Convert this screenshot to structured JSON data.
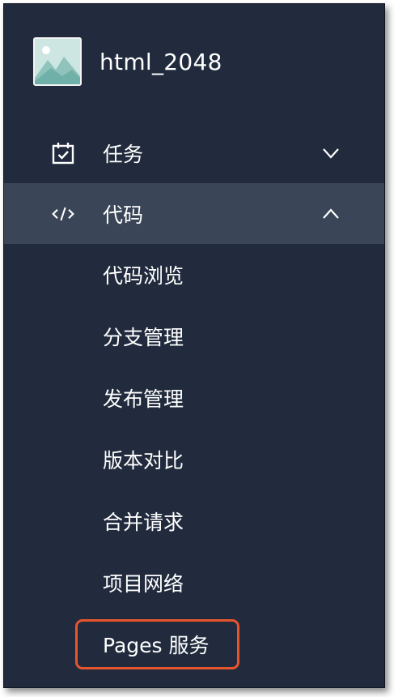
{
  "project": {
    "name": "html_2048",
    "avatar_icon": "mountain-image-icon"
  },
  "menu": {
    "tasks": {
      "label": "任务",
      "icon": "calendar-check-icon",
      "expanded": false
    },
    "code": {
      "label": "代码",
      "icon": "code-icon",
      "expanded": true,
      "active": true,
      "items": [
        {
          "label": "代码浏览"
        },
        {
          "label": "分支管理"
        },
        {
          "label": "发布管理"
        },
        {
          "label": "版本对比"
        },
        {
          "label": "合并请求"
        },
        {
          "label": "项目网络"
        },
        {
          "label": "Pages 服务",
          "highlighted": true
        }
      ]
    }
  },
  "colors": {
    "sidebar_bg": "#212b3d",
    "active_row_bg": "#3a4557",
    "text": "#ffffff",
    "highlight_border": "#e8552d"
  }
}
